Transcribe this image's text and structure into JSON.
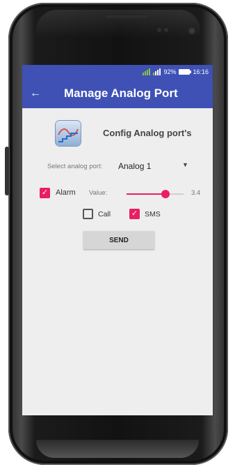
{
  "status_bar": {
    "battery_percent": "92%",
    "time": "16:16"
  },
  "toolbar": {
    "title": "Manage Analog Port",
    "back_icon": "arrow-back-icon"
  },
  "header": {
    "icon": "analog-chart-icon",
    "title": "Config Analog port's"
  },
  "port_select": {
    "label": "Select analog port:",
    "selected": "Analog 1",
    "arrow_icon": "dropdown-arrow-icon"
  },
  "alarm": {
    "checkbox_label": "Alarm",
    "checked": true,
    "value_label": "Value:",
    "value": "3.4",
    "slider_fraction": 0.68
  },
  "notify": {
    "call_label": "Call",
    "call_checked": false,
    "sms_label": "SMS",
    "sms_checked": true
  },
  "send_button": "SEND",
  "colors": {
    "primary": "#3f51b5",
    "accent": "#e91e63",
    "background": "#eeeeee"
  }
}
